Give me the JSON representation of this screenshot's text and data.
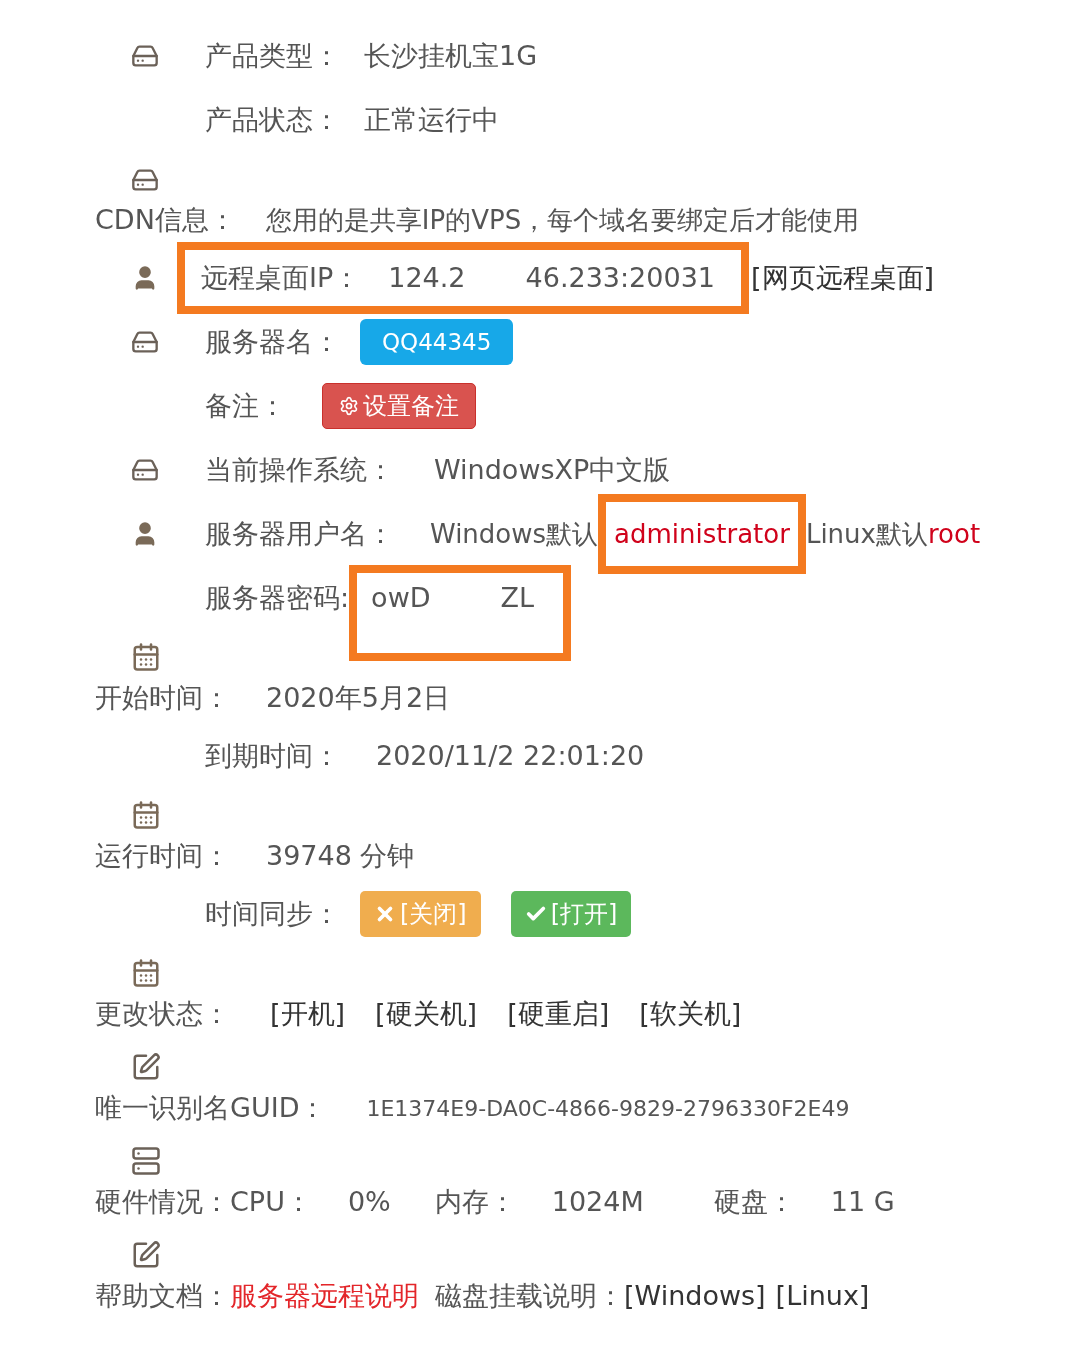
{
  "product_type": {
    "label": "产品类型：",
    "value": "长沙挂机宝1G"
  },
  "product_status": {
    "label": "产品状态：",
    "value": "正常运行中"
  },
  "cdn": {
    "label": "CDN信息：",
    "value": "您用的是共享IP的VPS，每个域名要绑定后才能使用"
  },
  "remote_ip": {
    "label": "远程桌面IP：",
    "value_start": "124.2",
    "value_end": "46.233:20031",
    "link": "[网页远程桌面]"
  },
  "server_name": {
    "label": "服务器名：",
    "badge": "QQ44345"
  },
  "note": {
    "label": "备注：",
    "button": "设置备注"
  },
  "os": {
    "label": "当前操作系统：",
    "value": "WindowsXP中文版"
  },
  "username": {
    "label": "服务器用户名：",
    "windows_text": "Windows默认",
    "windows_user": "administrator",
    "linux_text": "Linux默认",
    "linux_user": "root"
  },
  "password": {
    "label": "服务器密码:",
    "value_start": "owD",
    "value_end": "ZL"
  },
  "start_time": {
    "label": "开始时间：",
    "value": "2020年5月2日"
  },
  "expire_time": {
    "label": "到期时间：",
    "value": "2020/11/2 22:01:20"
  },
  "run_time": {
    "label": "运行时间：",
    "value": "39748 分钟"
  },
  "time_sync": {
    "label": "时间同步：",
    "buttons": [
      {
        "kind": "off",
        "label": "[关闭]"
      },
      {
        "kind": "on",
        "label": "[打开]"
      }
    ]
  },
  "change_state": {
    "label": "更改状态：",
    "actions": [
      "[开机]",
      "[硬关机]",
      "[硬重启]",
      "[软关机]"
    ]
  },
  "guid": {
    "label": "唯一识别名GUID：",
    "value": "1E1374E9-DA0C-4866-9829-2796330F2E49"
  },
  "hardware": {
    "label": "硬件情况：",
    "items": [
      {
        "label": "CPU：",
        "value": "0%"
      },
      {
        "label": "内存：",
        "value": "1024M"
      },
      {
        "label": "硬盘：",
        "value": "11 G"
      }
    ]
  },
  "help": {
    "label": "帮助文档：",
    "remote_doc": "服务器远程说明",
    "disk_label": "磁盘挂载说明：",
    "links": [
      "[Windows]",
      "[Linux]"
    ]
  }
}
